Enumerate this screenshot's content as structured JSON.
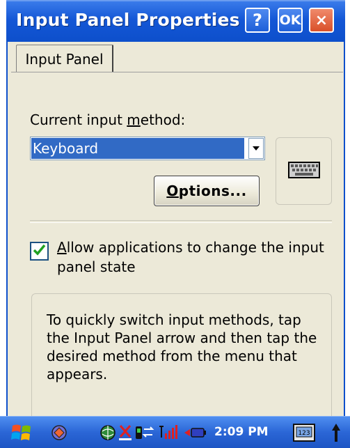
{
  "window": {
    "title": "Input Panel Properties",
    "help_label": "?",
    "ok_label": "OK",
    "close_label": "×"
  },
  "tabs": [
    {
      "label": "Input Panel",
      "active": true
    }
  ],
  "input_method": {
    "label_prefix": "Current input ",
    "label_accel": "m",
    "label_suffix": "ethod:",
    "selected": "Keyboard",
    "icon": "keyboard-icon"
  },
  "options_button": {
    "accel": "O",
    "rest": "ptions..."
  },
  "allow_checkbox": {
    "checked": true,
    "accel": "A",
    "rest": "llow applications to change the input panel state"
  },
  "info": {
    "text": "To quickly switch input methods, tap the Input Panel arrow and then tap the desired method from the menu that appears."
  },
  "taskbar": {
    "time": "2:09 PM",
    "icons": [
      "start-icon",
      "sync-icon",
      "globe-icon",
      "network-error-icon",
      "connection-icon",
      "signal-icon",
      "battery-icon",
      "input-panel-icon",
      "up-arrow-icon"
    ]
  },
  "colors": {
    "titlebar": "#1457d6",
    "window_bg": "#ece9d8",
    "selection": "#316ac5",
    "close_button": "#d9502a",
    "check": "#21a121"
  }
}
